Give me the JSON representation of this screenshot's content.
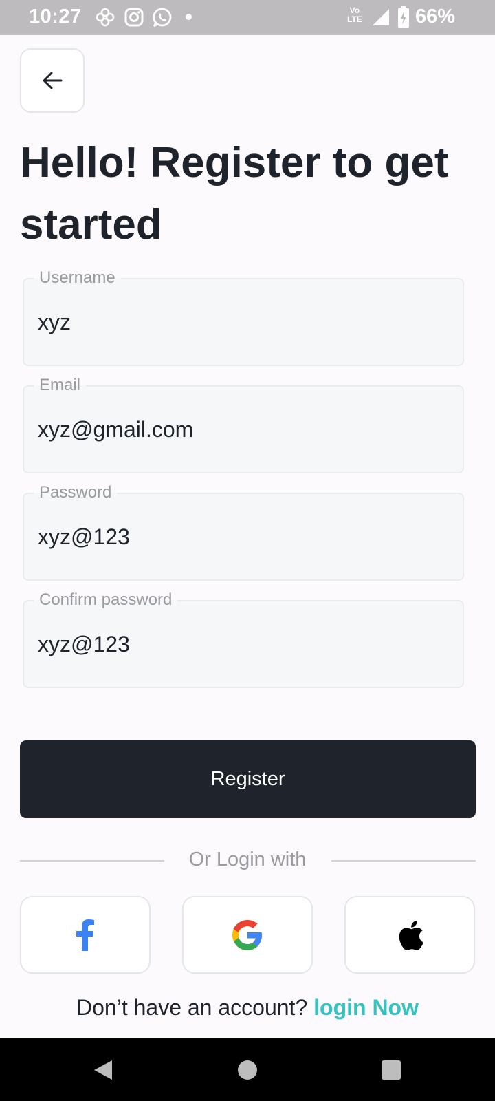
{
  "status_bar": {
    "time": "10:27",
    "volte_line1": "Vo",
    "volte_line2": "LTE",
    "battery": "66%",
    "icons": [
      "bluetooth-fan-icon",
      "instagram-icon",
      "whatsapp-icon",
      "notification-dot",
      "signal-icon",
      "battery-icon"
    ]
  },
  "header": {
    "back_icon": "arrow-left-icon",
    "title": "Hello! Register to get started"
  },
  "form": {
    "username": {
      "label": "Username",
      "value": "xyz"
    },
    "email": {
      "label": "Email",
      "value": "xyz@gmail.com"
    },
    "password": {
      "label": "Password",
      "value": "xyz@123"
    },
    "confirm_password": {
      "label": "Confirm password",
      "value": "xyz@123"
    },
    "submit_label": "Register"
  },
  "social": {
    "divider_text": "Or Login with",
    "providers": [
      "facebook-icon",
      "google-icon",
      "apple-icon"
    ]
  },
  "footer": {
    "prompt": "Don’t have an account? ",
    "link": "login Now"
  },
  "colors": {
    "primary_dark": "#1e232c",
    "accent_teal": "#35c2c1",
    "field_bg": "#f5f7f8",
    "status_bar_bg": "#bdbbbd"
  }
}
